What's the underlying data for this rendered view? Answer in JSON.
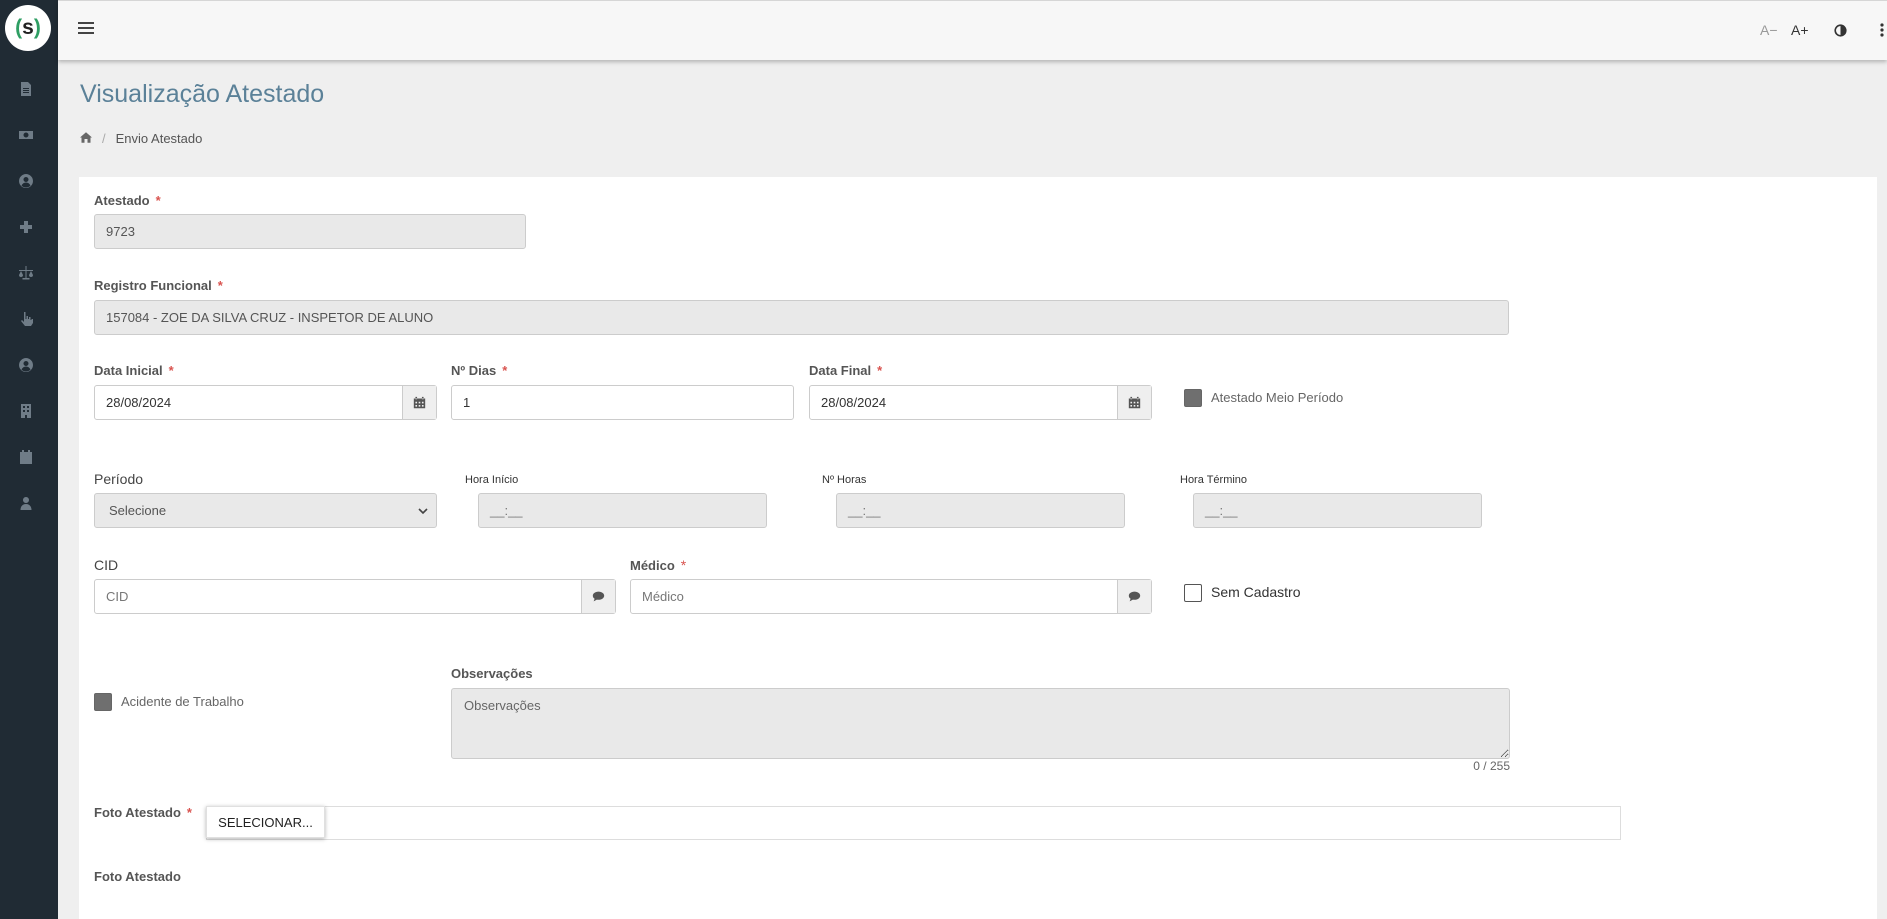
{
  "app": {
    "logo_text": "s"
  },
  "sidebar": {
    "icons": [
      "document-icon",
      "money-icon",
      "user-circle-icon",
      "plus-icon",
      "scale-icon",
      "hand-pointer-icon",
      "user-circle-2-icon",
      "building-icon",
      "calendar-icon",
      "user-icon"
    ]
  },
  "topbar": {
    "font_decrease": "A−",
    "font_increase": "A+",
    "contrast_icon": "contrast-icon",
    "more_icon": "vertical-dots-icon"
  },
  "page": {
    "title": "Visualização Atestado",
    "breadcrumb": {
      "home_icon": "home-icon",
      "current": "Envio Atestado"
    }
  },
  "form": {
    "atestado": {
      "label": "Atestado",
      "required": "*",
      "value": "9723"
    },
    "registro": {
      "label": "Registro Funcional",
      "required": "*",
      "value": "157084 - ZOE DA SILVA CRUZ - INSPETOR DE ALUNO"
    },
    "data_inicial": {
      "label": "Data Inicial",
      "required": "*",
      "value": "28/08/2024"
    },
    "n_dias": {
      "label": "Nº Dias",
      "required": "*",
      "value": "1"
    },
    "data_final": {
      "label": "Data Final",
      "required": "*",
      "value": "28/08/2024"
    },
    "meio_periodo": {
      "label": "Atestado Meio Período",
      "checked": true
    },
    "periodo": {
      "label": "Período",
      "selected": "Selecione"
    },
    "hora_inicio": {
      "label": "Hora Início",
      "placeholder": "__:__"
    },
    "n_horas": {
      "label": "Nº Horas",
      "placeholder": "__:__"
    },
    "hora_termino": {
      "label": "Hora Término",
      "placeholder": "__:__"
    },
    "cid": {
      "label": "CID",
      "placeholder": "CID"
    },
    "medico": {
      "label": "Médico",
      "required": "*",
      "placeholder": "Médico"
    },
    "sem_cadastro": {
      "label": "Sem Cadastro",
      "checked": false
    },
    "acidente": {
      "label": "Acidente de Trabalho",
      "checked": true
    },
    "observacoes": {
      "label": "Observações",
      "placeholder": "Observações",
      "counter": "0 / 255"
    },
    "foto": {
      "label": "Foto Atestado",
      "required": "*",
      "button": "SELECIONAR...",
      "preview_label": "Foto Atestado"
    }
  },
  "colors": {
    "sidebar": "#202b34",
    "title": "#5b8198",
    "required": "#d9534f",
    "accent": "#2e9e63"
  }
}
